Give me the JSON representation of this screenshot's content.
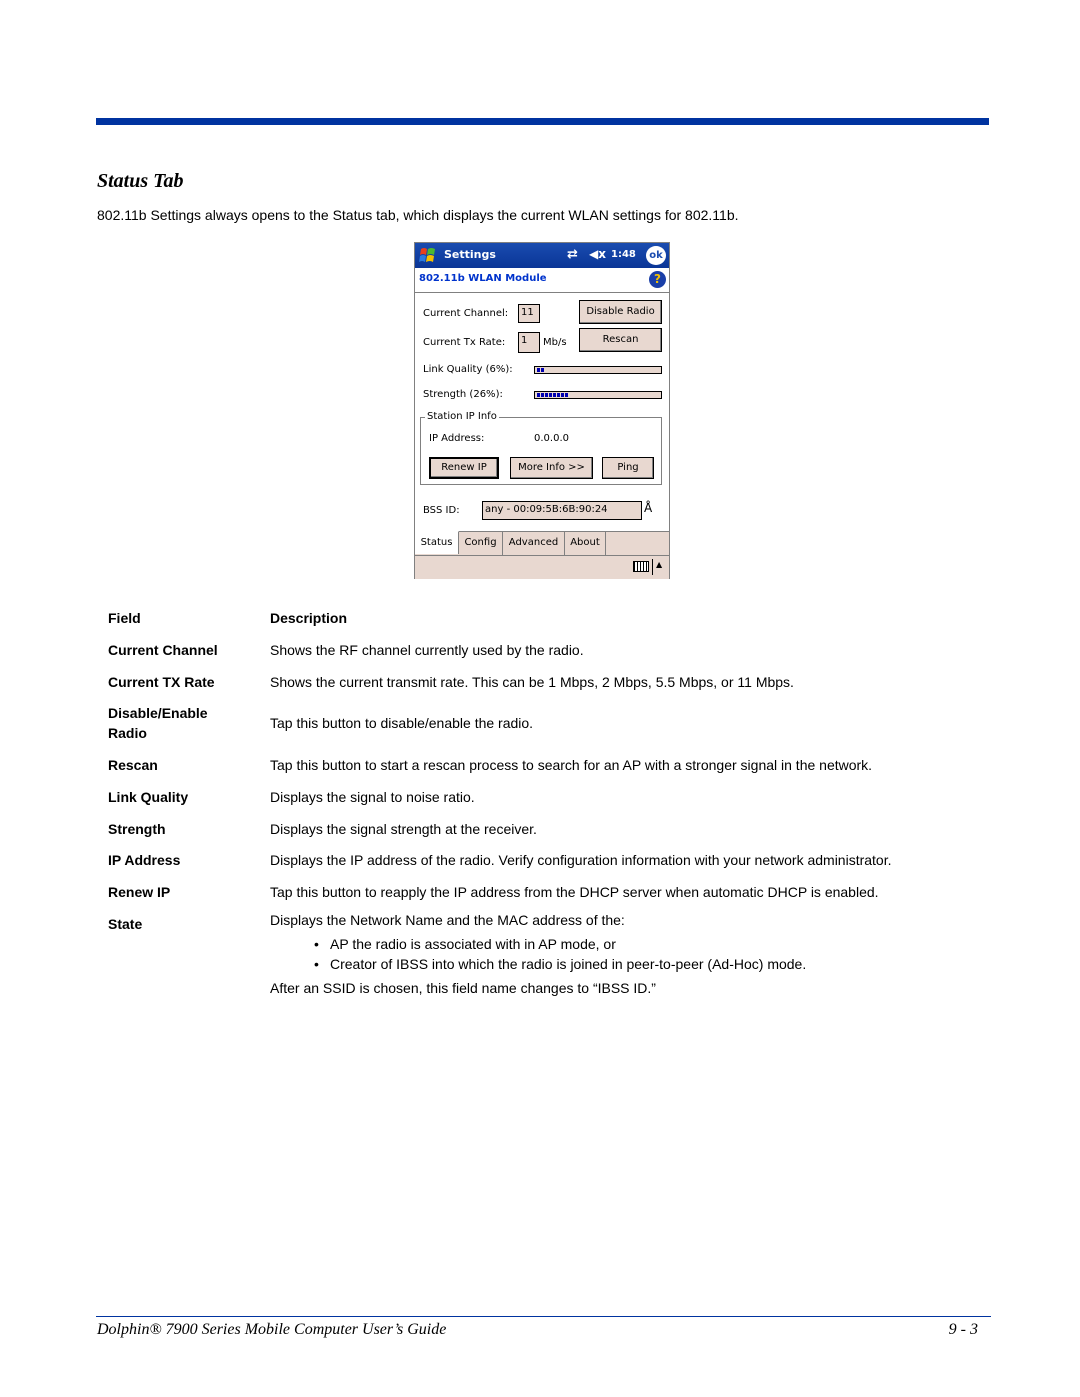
{
  "section_title": "Status Tab",
  "intro": "802.11b Settings always opens to the Status tab, which displays the current WLAN settings for 802.11b.",
  "pda": {
    "titlebar": {
      "title": "Settings",
      "sync_icon": "⇄",
      "volume_icon": "◀x",
      "time": "1:48",
      "ok_label": "ok"
    },
    "header": {
      "title": "802.11b WLAN Module",
      "help_icon": "?"
    },
    "current_channel": {
      "label": "Current Channel:",
      "value": "11"
    },
    "current_tx_rate": {
      "label": "Current Tx Rate:",
      "value": "1",
      "unit": "Mb/s"
    },
    "buttons": {
      "disable_radio": "Disable Radio",
      "rescan": "Rescan",
      "renew_ip": "Renew IP",
      "more_info": "More Info >>",
      "ping": "Ping"
    },
    "link_quality": {
      "label": "Link Quality (6%):",
      "percent": 6
    },
    "strength": {
      "label": "Strength (26%):",
      "percent": 26
    },
    "station_ip_info": {
      "legend": "Station IP Info",
      "ip_label": "IP Address:",
      "ip_value": "0.0.0.0"
    },
    "bss_id": {
      "label": "BSS ID:",
      "value": "any - 00:09:5B:6B:90:24",
      "antenna_icon": "Å"
    },
    "tabs": [
      {
        "label": "Status",
        "active": true
      },
      {
        "label": "Config",
        "active": false
      },
      {
        "label": "Advanced",
        "active": false
      },
      {
        "label": "About",
        "active": false
      }
    ],
    "menubar": {
      "arrow_icon": "▲"
    }
  },
  "table": {
    "headers": {
      "field": "Field",
      "description": "Description"
    },
    "rows": [
      {
        "field": "Current Channel",
        "description": "Shows the RF channel currently used by the radio."
      },
      {
        "field": "Current TX Rate",
        "description": "Shows the current transmit rate. This can be 1 Mbps, 2 Mbps, 5.5 Mbps, or 11 Mbps."
      },
      {
        "field": "Disable/Enable Radio",
        "description": "Tap this button to disable/enable the radio."
      },
      {
        "field": "Rescan",
        "description": "Tap this button to start a rescan process to search for an AP with a stronger signal in the network."
      },
      {
        "field": "Link Quality",
        "description": "Displays the signal to noise ratio."
      },
      {
        "field": "Strength",
        "description": "Displays the signal strength at the receiver."
      },
      {
        "field": "IP Address",
        "description": "Displays the IP address of the radio. Verify configuration information with your network administrator."
      },
      {
        "field": "Renew IP",
        "description": "Tap this button to reapply the IP address from the DHCP server when automatic DHCP is enabled."
      },
      {
        "field": "State",
        "description": "Displays the Network Name and the MAC address of the:",
        "bullets": [
          "AP the radio is associated with in AP mode, or",
          "Creator of IBSS into which the radio is joined in peer-to-peer (Ad-Hoc) mode."
        ],
        "after": "After an SSID is chosen, this field name changes to “IBSS ID.”"
      }
    ]
  },
  "footer": {
    "title": "Dolphin® 7900 Series Mobile Computer User’s Guide",
    "page": "9 - 3"
  }
}
